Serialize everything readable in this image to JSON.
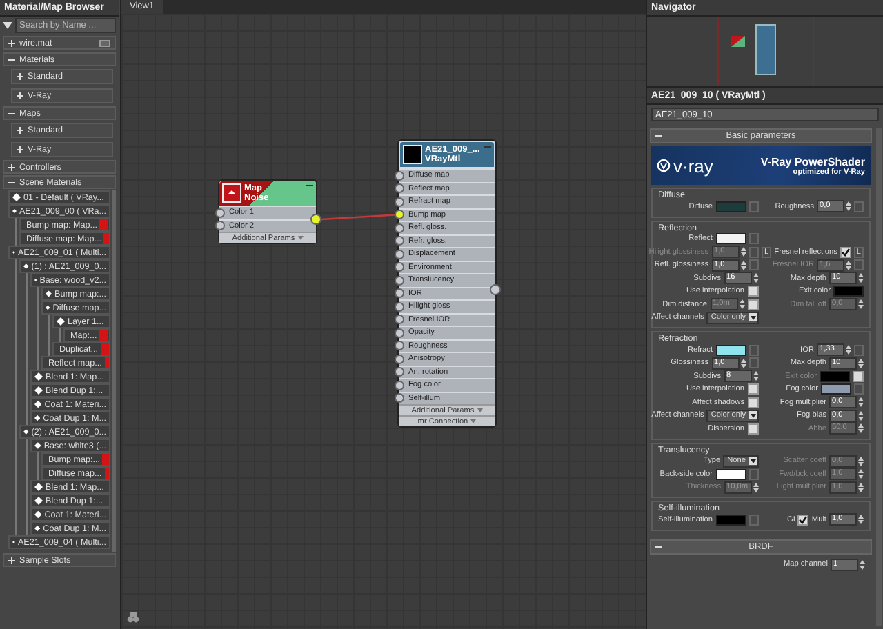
{
  "browser": {
    "title": "Material/Map Browser",
    "search": {
      "placeholder": "Search by Name ..."
    },
    "groups": [
      {
        "label": "wire.mat",
        "expanded": false,
        "kind": "library"
      },
      {
        "label": "Materials",
        "expanded": true,
        "kind": "category",
        "items": [
          {
            "label": "Standard",
            "expanded": false
          },
          {
            "label": "V-Ray",
            "expanded": false
          }
        ]
      },
      {
        "label": "Maps",
        "expanded": true,
        "kind": "category",
        "items": [
          {
            "label": "Standard",
            "expanded": false
          },
          {
            "label": "V-Ray",
            "expanded": false
          }
        ]
      },
      {
        "label": "Controllers",
        "expanded": false,
        "kind": "category"
      },
      {
        "label": "Scene Materials",
        "expanded": true,
        "kind": "category",
        "tree": [
          {
            "label": "01 - Default  ( VRay...",
            "swatch": false
          },
          {
            "label": "AE21_009_00  ( VRa...",
            "swatch": false,
            "children": [
              {
                "label": "Bump map: Map...",
                "swatch": true
              },
              {
                "label": "Diffuse map: Map...",
                "swatch": true
              }
            ]
          },
          {
            "label": "AE21_009_01  ( Multi...",
            "swatch": false,
            "children": [
              {
                "label": "(1) : AE21_009_0...",
                "swatch": false,
                "children": [
                  {
                    "label": "Base: wood_v2...",
                    "swatch": false,
                    "children": [
                      {
                        "label": "Bump map:...",
                        "swatch": false
                      },
                      {
                        "label": "Diffuse map...",
                        "swatch": false,
                        "children": [
                          {
                            "label": "Layer 1...",
                            "swatch": false,
                            "children": [
                              {
                                "label": "Map:...",
                                "swatch": true
                              }
                            ]
                          },
                          {
                            "label": "Duplicat...",
                            "swatch": true
                          }
                        ]
                      },
                      {
                        "label": "Reflect map...",
                        "swatch": true
                      }
                    ]
                  },
                  {
                    "label": "Blend 1: Map...",
                    "swatch": false
                  },
                  {
                    "label": "Blend Dup 1:...",
                    "swatch": false
                  },
                  {
                    "label": "Coat 1: Materi...",
                    "swatch": false
                  },
                  {
                    "label": "Coat Dup 1: M...",
                    "swatch": false
                  }
                ]
              },
              {
                "label": "(2) : AE21_009_0...",
                "swatch": false,
                "children": [
                  {
                    "label": "Base: white3  (...",
                    "swatch": false,
                    "children": [
                      {
                        "label": "Bump map:...",
                        "swatch": true
                      },
                      {
                        "label": "Diffuse map...",
                        "swatch": true
                      }
                    ]
                  },
                  {
                    "label": "Blend 1: Map...",
                    "swatch": false
                  },
                  {
                    "label": "Blend Dup 1:...",
                    "swatch": false
                  },
                  {
                    "label": "Coat 1: Materi...",
                    "swatch": false
                  },
                  {
                    "label": "Coat Dup 1: M...",
                    "swatch": false
                  }
                ]
              }
            ]
          },
          {
            "label": "AE21_009_04  ( Multi...",
            "swatch": false
          }
        ]
      },
      {
        "label": "Sample Slots",
        "expanded": false,
        "kind": "category"
      }
    ]
  },
  "view": {
    "tab": "View1",
    "nodes": [
      {
        "kind": "map",
        "title": "Map",
        "subtitle": "Noise",
        "output_connected": true,
        "slots": [
          {
            "label": "Color 1",
            "connected": false
          },
          {
            "label": "Color 2",
            "connected": false
          }
        ],
        "footers": [
          "Additional Params"
        ]
      },
      {
        "kind": "material",
        "title": "AE21_009_...",
        "subtitle": "VRayMtl",
        "output_connected": false,
        "slots": [
          {
            "label": "Diffuse map",
            "connected": false
          },
          {
            "label": "Reflect map",
            "connected": false
          },
          {
            "label": "Refract map",
            "connected": false
          },
          {
            "label": "Bump map",
            "connected": true
          },
          {
            "label": "Refl. gloss.",
            "connected": false
          },
          {
            "label": "Refr. gloss.",
            "connected": false
          },
          {
            "label": "Displacement",
            "connected": false
          },
          {
            "label": "Environment",
            "connected": false
          },
          {
            "label": "Translucency",
            "connected": false
          },
          {
            "label": "IOR",
            "connected": false
          },
          {
            "label": "Hilight gloss",
            "connected": false
          },
          {
            "label": "Fresnel IOR",
            "connected": false
          },
          {
            "label": "Opacity",
            "connected": false
          },
          {
            "label": "Roughness",
            "connected": false
          },
          {
            "label": "Anisotropy",
            "connected": false
          },
          {
            "label": "An. rotation",
            "connected": false
          },
          {
            "label": "Fog color",
            "connected": false
          },
          {
            "label": "Self-illum",
            "connected": false
          }
        ],
        "footers": [
          "Additional Params",
          "mr Connection"
        ]
      }
    ]
  },
  "navigator": {
    "title": "Navigator"
  },
  "editor": {
    "title": "AE21_009_10  ( VRayMtl )",
    "name": "AE21_009_10",
    "rollouts": [
      {
        "title": "Basic parameters",
        "expanded": true,
        "banner": {
          "logo": "v·ray",
          "title": "V-Ray PowerShader",
          "subtitle": "optimized for V-Ray"
        },
        "groups": [
          {
            "title": "Diffuse",
            "rows": [
              {
                "left": [
                  {
                    "kind": "label",
                    "text": "Diffuse"
                  },
                  {
                    "kind": "color",
                    "color": "#1d3c3c"
                  },
                  {
                    "kind": "map"
                  }
                ],
                "right": [
                  {
                    "kind": "label",
                    "text": "Roughness"
                  },
                  {
                    "kind": "spinner",
                    "value": "0,0",
                    "disabled": false
                  },
                  {
                    "kind": "map"
                  }
                ]
              }
            ]
          },
          {
            "title": "Reflection",
            "rows": [
              {
                "left": [
                  {
                    "kind": "label",
                    "text": "Reflect"
                  },
                  {
                    "kind": "color",
                    "color": "#f2f2f2"
                  },
                  {
                    "kind": "map"
                  }
                ],
                "right": []
              },
              {
                "left": [
                  {
                    "kind": "label",
                    "text": "Hilight glossiness",
                    "disabled": true
                  },
                  {
                    "kind": "spinner",
                    "value": "1,0",
                    "disabled": true
                  },
                  {
                    "kind": "map"
                  }
                ],
                "right": [
                  {
                    "kind": "button",
                    "text": "L"
                  },
                  {
                    "kind": "label",
                    "text": "Fresnel reflections"
                  },
                  {
                    "kind": "check",
                    "checked": true
                  },
                  {
                    "kind": "button",
                    "text": "L"
                  }
                ]
              },
              {
                "left": [
                  {
                    "kind": "label",
                    "text": "Refl. glossiness"
                  },
                  {
                    "kind": "spinner",
                    "value": "1,0",
                    "disabled": false
                  },
                  {
                    "kind": "map"
                  }
                ],
                "right": [
                  {
                    "kind": "label",
                    "text": "Fresnel IOR",
                    "disabled": true
                  },
                  {
                    "kind": "spinner",
                    "value": "1,6",
                    "disabled": true
                  },
                  {
                    "kind": "map"
                  }
                ]
              },
              {
                "left": [
                  {
                    "kind": "label",
                    "text": "Subdivs"
                  },
                  {
                    "kind": "spinner",
                    "value": "16",
                    "disabled": false
                  }
                ],
                "right": [
                  {
                    "kind": "label",
                    "text": "Max depth"
                  },
                  {
                    "kind": "spinner",
                    "value": "10",
                    "disabled": false
                  }
                ]
              },
              {
                "left": [
                  {
                    "kind": "label",
                    "text": "Use interpolation"
                  },
                  {
                    "kind": "check",
                    "checked": false
                  }
                ],
                "right": [
                  {
                    "kind": "label",
                    "text": "Exit color"
                  },
                  {
                    "kind": "color",
                    "color": "#000000"
                  }
                ]
              },
              {
                "left": [
                  {
                    "kind": "label",
                    "text": "Dim distance"
                  },
                  {
                    "kind": "spinner",
                    "value": "1,0m",
                    "disabled": true
                  },
                  {
                    "kind": "check",
                    "checked": false
                  }
                ],
                "right": [
                  {
                    "kind": "label",
                    "text": "Dim fall off",
                    "disabled": true
                  },
                  {
                    "kind": "spinner",
                    "value": "0,0",
                    "disabled": true
                  }
                ]
              },
              {
                "left": [
                  {
                    "kind": "label",
                    "text": "Affect channels"
                  },
                  {
                    "kind": "dropdown",
                    "value": "Color only"
                  }
                ],
                "right": []
              }
            ]
          },
          {
            "title": "Refraction",
            "rows": [
              {
                "left": [
                  {
                    "kind": "label",
                    "text": "Refract"
                  },
                  {
                    "kind": "color",
                    "color": "#8fe3ec"
                  },
                  {
                    "kind": "map"
                  }
                ],
                "right": [
                  {
                    "kind": "label",
                    "text": "IOR"
                  },
                  {
                    "kind": "spinner",
                    "value": "1,33",
                    "disabled": false
                  },
                  {
                    "kind": "map"
                  }
                ]
              },
              {
                "left": [
                  {
                    "kind": "label",
                    "text": "Glossiness"
                  },
                  {
                    "kind": "spinner",
                    "value": "1,0",
                    "disabled": false
                  },
                  {
                    "kind": "map"
                  }
                ],
                "right": [
                  {
                    "kind": "label",
                    "text": "Max depth"
                  },
                  {
                    "kind": "spinner",
                    "value": "10",
                    "disabled": false
                  }
                ]
              },
              {
                "left": [
                  {
                    "kind": "label",
                    "text": "Subdivs"
                  },
                  {
                    "kind": "spinner",
                    "value": "8",
                    "disabled": false
                  }
                ],
                "right": [
                  {
                    "kind": "label",
                    "text": "Exit color",
                    "disabled": true
                  },
                  {
                    "kind": "color",
                    "color": "#000000"
                  },
                  {
                    "kind": "check",
                    "checked": false
                  }
                ]
              },
              {
                "left": [
                  {
                    "kind": "label",
                    "text": "Use interpolation"
                  },
                  {
                    "kind": "check",
                    "checked": false
                  }
                ],
                "right": [
                  {
                    "kind": "label",
                    "text": "Fog color"
                  },
                  {
                    "kind": "color",
                    "color": "#8e9aae"
                  },
                  {
                    "kind": "map"
                  }
                ]
              },
              {
                "left": [
                  {
                    "kind": "label",
                    "text": "Affect shadows"
                  },
                  {
                    "kind": "check",
                    "checked": false
                  }
                ],
                "right": [
                  {
                    "kind": "label",
                    "text": "Fog multiplier"
                  },
                  {
                    "kind": "spinner",
                    "value": "0,0",
                    "disabled": false
                  }
                ]
              },
              {
                "left": [
                  {
                    "kind": "label",
                    "text": "Affect channels"
                  },
                  {
                    "kind": "dropdown",
                    "value": "Color only"
                  }
                ],
                "right": [
                  {
                    "kind": "label",
                    "text": "Fog bias"
                  },
                  {
                    "kind": "spinner",
                    "value": "0,0",
                    "disabled": false
                  }
                ]
              },
              {
                "left": [
                  {
                    "kind": "label",
                    "text": "Dispersion"
                  },
                  {
                    "kind": "check",
                    "checked": false
                  }
                ],
                "right": [
                  {
                    "kind": "label",
                    "text": "Abbe",
                    "disabled": true
                  },
                  {
                    "kind": "spinner",
                    "value": "50,0",
                    "disabled": true
                  }
                ]
              }
            ]
          },
          {
            "title": "Translucency",
            "rows": [
              {
                "left": [
                  {
                    "kind": "label",
                    "text": "Type"
                  },
                  {
                    "kind": "dropdown",
                    "value": "None"
                  }
                ],
                "right": [
                  {
                    "kind": "label",
                    "text": "Scatter coeff",
                    "disabled": true
                  },
                  {
                    "kind": "spinner",
                    "value": "0,0",
                    "disabled": true
                  }
                ]
              },
              {
                "left": [
                  {
                    "kind": "label",
                    "text": "Back-side color"
                  },
                  {
                    "kind": "color",
                    "color": "#ffffff"
                  },
                  {
                    "kind": "map"
                  }
                ],
                "right": [
                  {
                    "kind": "label",
                    "text": "Fwd/bck coeff",
                    "disabled": true
                  },
                  {
                    "kind": "spinner",
                    "value": "1,0",
                    "disabled": true
                  }
                ]
              },
              {
                "left": [
                  {
                    "kind": "label",
                    "text": "Thickness",
                    "disabled": true
                  },
                  {
                    "kind": "spinner",
                    "value": "10,0m",
                    "disabled": true
                  }
                ],
                "right": [
                  {
                    "kind": "label",
                    "text": "Light multiplier",
                    "disabled": true
                  },
                  {
                    "kind": "spinner",
                    "value": "1,0",
                    "disabled": true
                  }
                ]
              }
            ]
          },
          {
            "title": "Self-illumination",
            "rows": [
              {
                "left": [
                  {
                    "kind": "label",
                    "text": "Self-illumination"
                  },
                  {
                    "kind": "color",
                    "color": "#000000"
                  },
                  {
                    "kind": "map"
                  }
                ],
                "right": [
                  {
                    "kind": "label",
                    "text": "GI"
                  },
                  {
                    "kind": "check",
                    "checked": true
                  },
                  {
                    "kind": "label",
                    "text": "Mult"
                  },
                  {
                    "kind": "spinner",
                    "value": "1,0",
                    "disabled": false
                  }
                ]
              }
            ]
          }
        ]
      },
      {
        "title": "BRDF",
        "expanded": true,
        "groups": [
          {
            "rows": [
              {
                "left": [],
                "right": [
                  {
                    "kind": "label",
                    "text": "Map channel"
                  },
                  {
                    "kind": "spinner",
                    "value": "1",
                    "disabled": false
                  }
                ]
              }
            ]
          }
        ]
      }
    ]
  }
}
